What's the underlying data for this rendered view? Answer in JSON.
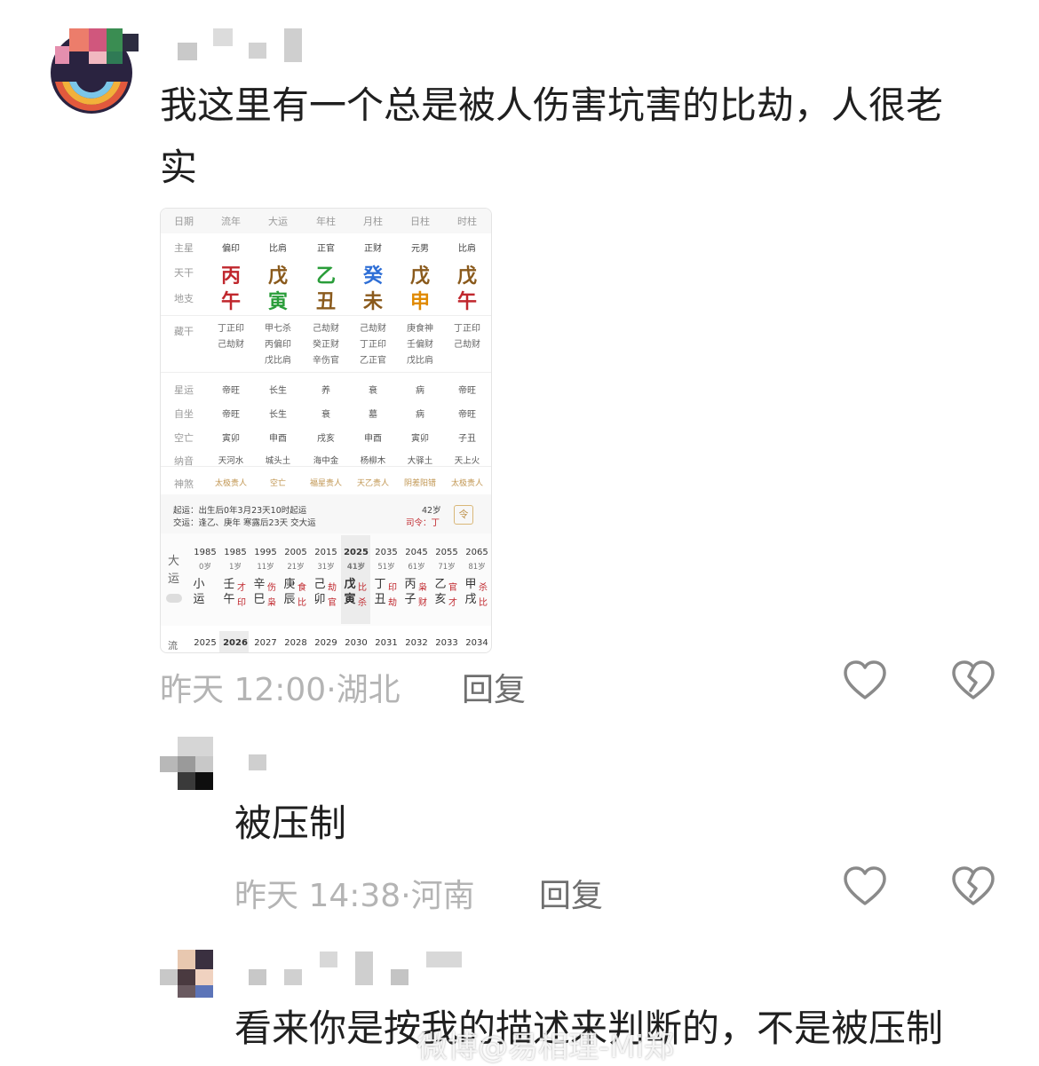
{
  "comments": [
    {
      "text_line1": "我这里有一个总是被人伤害坑害的比劫，人很老",
      "text_line2": "实",
      "time": "昨天 12:00",
      "location": "湖北",
      "reply": "回复",
      "like_icon": "heart-outline-icon",
      "dislike_icon": "broken-heart-icon"
    },
    {
      "text": "被压制",
      "time": "昨天 14:38",
      "location": "河南",
      "reply": "回复",
      "like_icon": "heart-outline-icon",
      "dislike_icon": "broken-heart-icon"
    },
    {
      "text": "看来你是按我的描述来判断的，不是被压制"
    }
  ],
  "bazi": {
    "headers": [
      "日期",
      "流年",
      "大运",
      "年柱",
      "月柱",
      "日柱",
      "时柱"
    ],
    "row_labels": {
      "zhuxing": "主星",
      "tiangan": "天干",
      "dizhi": "地支",
      "canggan": "藏干",
      "xingyun": "星运",
      "zizuo": "自坐",
      "kongwang": "空亡",
      "nayin": "纳音",
      "shensha": "神煞"
    },
    "zhuxing": [
      "偏印",
      "比肩",
      "正官",
      "正财",
      "元男",
      "比肩"
    ],
    "tiangan": [
      "丙",
      "戊",
      "乙",
      "癸",
      "戊",
      "戊"
    ],
    "tiangan_colors": [
      "#c0272d",
      "#8a5a1c",
      "#2a9d3a",
      "#2f6fd6",
      "#8a5a1c",
      "#8a5a1c"
    ],
    "dizhi": [
      "午",
      "寅",
      "丑",
      "未",
      "申",
      "午"
    ],
    "dizhi_colors": [
      "#c0272d",
      "#2a9d3a",
      "#8a5a1c",
      "#8a5a1c",
      "#e08a00",
      "#c0272d"
    ],
    "canggan": [
      [
        "丁正印",
        "己劫财"
      ],
      [
        "甲七杀",
        "丙偏印",
        "戊比肩"
      ],
      [
        "己劫财",
        "癸正财",
        "辛伤官"
      ],
      [
        "己劫财",
        "丁正印",
        "乙正官"
      ],
      [
        "庚食神",
        "壬偏财",
        "戊比肩"
      ],
      [
        "丁正印",
        "己劫财"
      ]
    ],
    "xingyun": [
      "帝旺",
      "长生",
      "养",
      "衰",
      "病",
      "帝旺"
    ],
    "zizuo": [
      "帝旺",
      "长生",
      "衰",
      "墓",
      "病",
      "帝旺"
    ],
    "kongwang": [
      "寅卯",
      "申酉",
      "戌亥",
      "申酉",
      "寅卯",
      "子丑"
    ],
    "nayin": [
      "天河水",
      "城头土",
      "海中金",
      "杨柳木",
      "大驿土",
      "天上火"
    ],
    "shensha": [
      "太极贵人",
      "空亡",
      "福星贵人",
      "天乙贵人",
      "阴差阳错",
      "太极贵人"
    ],
    "qiyun": "起运：出生后0年3月23天10时起运",
    "jiaoyun": "交运：逢乙、庚年 寒露后23天 交大运",
    "age": "42岁",
    "siling": "司令：丁",
    "dayun_label": "大运",
    "xiaoyun_label": "小运",
    "dayun": [
      {
        "year": "1985",
        "age": "0岁",
        "gz1": "小",
        "gz2": "运",
        "t1": "",
        "t2": ""
      },
      {
        "year": "1985",
        "age": "1岁",
        "gz1": "壬",
        "gz2": "午",
        "t1": "才",
        "t2": "印"
      },
      {
        "year": "1995",
        "age": "11岁",
        "gz1": "辛",
        "gz2": "巳",
        "t1": "伤",
        "t2": "枭"
      },
      {
        "year": "2005",
        "age": "21岁",
        "gz1": "庚",
        "gz2": "辰",
        "t1": "食",
        "t2": "比"
      },
      {
        "year": "2015",
        "age": "31岁",
        "gz1": "己",
        "gz2": "卯",
        "t1": "劫",
        "t2": "官"
      },
      {
        "year": "2025",
        "age": "41岁",
        "gz1": "戊",
        "gz2": "寅",
        "t1": "比",
        "t2": "杀"
      },
      {
        "year": "2035",
        "age": "51岁",
        "gz1": "丁",
        "gz2": "丑",
        "t1": "印",
        "t2": "劫"
      },
      {
        "year": "2045",
        "age": "61岁",
        "gz1": "丙",
        "gz2": "子",
        "t1": "枭",
        "t2": "财"
      },
      {
        "year": "2055",
        "age": "71岁",
        "gz1": "乙",
        "gz2": "亥",
        "t1": "官",
        "t2": "才"
      },
      {
        "year": "2065",
        "age": "81岁",
        "gz1": "甲",
        "gz2": "戌",
        "t1": "杀",
        "t2": "比"
      }
    ],
    "liunian_label": "流",
    "liunian": [
      "2025",
      "2026",
      "2027",
      "2028",
      "2029",
      "2030",
      "2031",
      "2032",
      "2033",
      "2034"
    ]
  },
  "watermark": "微博@易相理-Mi郑",
  "colors": {
    "accent_red": "#c0272d",
    "muted": "#b4b4b4",
    "shensha": "#c09550"
  }
}
